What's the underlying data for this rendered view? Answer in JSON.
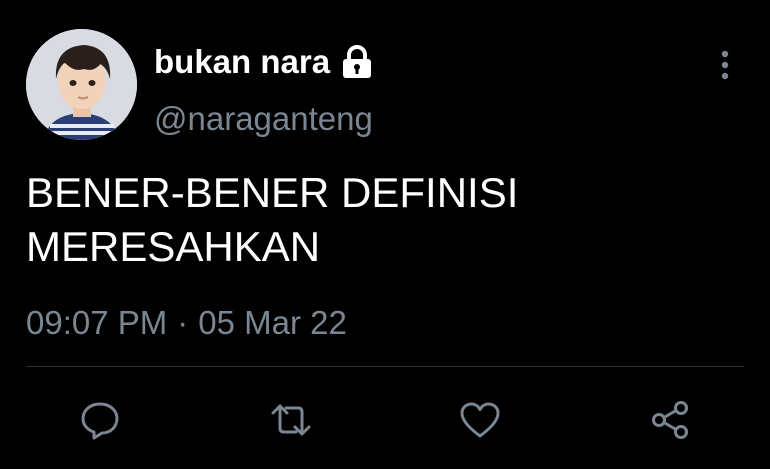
{
  "author": {
    "display_name": "bukan nara",
    "handle": "@naraganteng",
    "protected_icon": "lock-icon",
    "avatar": "child-portrait"
  },
  "tweet": {
    "text": "BENER-BENER DEFINISI\nMERESAHKAN",
    "time": "09:07 PM",
    "separator": "·",
    "date": "05 Mar 22"
  },
  "menu": {
    "icon": "more-vertical-icon"
  },
  "actions": [
    {
      "icon": "reply-icon"
    },
    {
      "icon": "retweet-icon"
    },
    {
      "icon": "like-icon"
    },
    {
      "icon": "share-icon"
    }
  ],
  "colors": {
    "background": "#000000",
    "text": "#ffffff",
    "secondary": "#7a8691",
    "divider": "#2f3336"
  }
}
